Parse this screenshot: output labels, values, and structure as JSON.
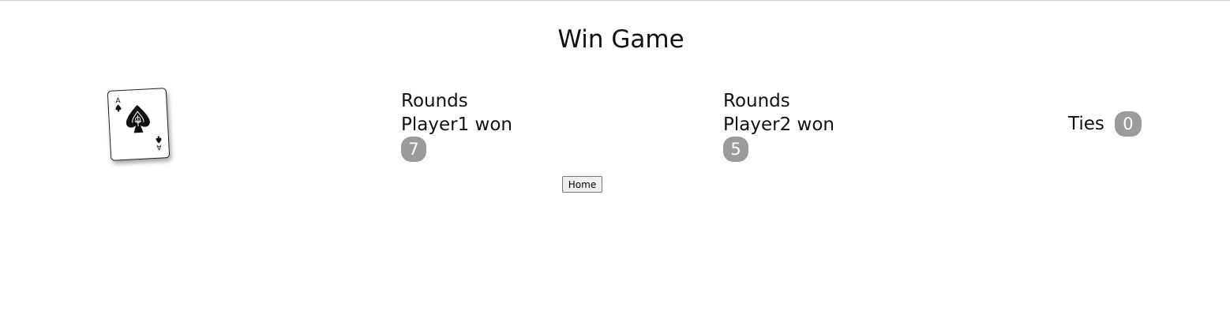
{
  "page": {
    "title": "Win Game"
  },
  "card": {
    "rank": "A",
    "suit": "spade",
    "icon": "ace-of-spades-icon"
  },
  "player1": {
    "line1": "Rounds",
    "line2": "Player1 won",
    "count": "7"
  },
  "player2": {
    "line1": "Rounds",
    "line2": "Player2 won",
    "count": "5"
  },
  "ties": {
    "label": "Ties",
    "count": "0"
  },
  "nav": {
    "home_label": "Home"
  },
  "colors": {
    "badge": "#9b9b9b"
  }
}
